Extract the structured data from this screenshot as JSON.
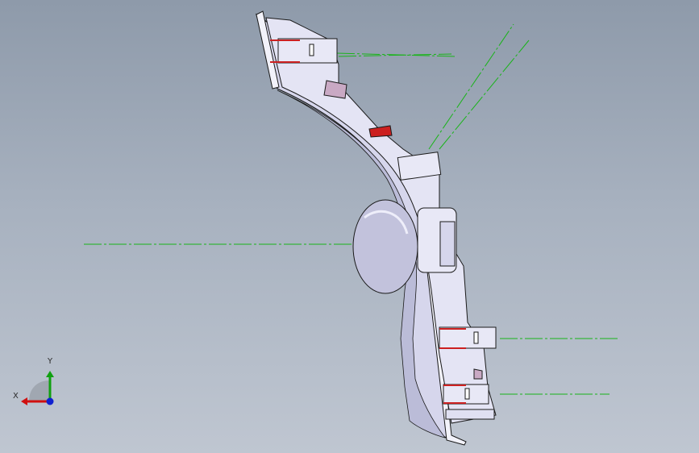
{
  "viewport": {
    "background_top": "#8e9aaa",
    "background_bottom": "#bfc6d1"
  },
  "model": {
    "name": "",
    "face_color": "#dcdcf0",
    "shadow_color": "#a9aacb",
    "edge_color": "#1a1a1a",
    "rib_color": "#cc2020",
    "centerline_color": "#19b419"
  },
  "triad": {
    "x_label": "X",
    "y_label": "Y",
    "x_color": "#d01010",
    "y_color": "#10a010",
    "z_color": "#1020d0",
    "icons": [
      "triad-x-arrow-icon",
      "triad-y-arrow-icon",
      "triad-z-dot-icon"
    ]
  }
}
